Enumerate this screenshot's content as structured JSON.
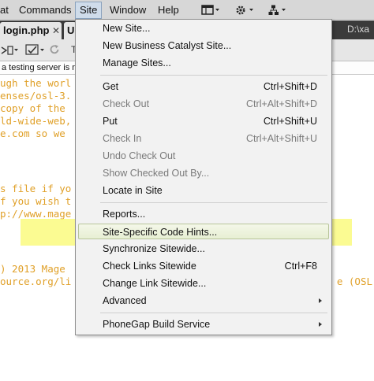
{
  "menubar": {
    "items": [
      {
        "label": "at"
      },
      {
        "label": "Commands"
      },
      {
        "label": "Site"
      },
      {
        "label": "Window"
      },
      {
        "label": "Help"
      }
    ],
    "icons": [
      "layout-icon",
      "gear-icon",
      "site-structure-icon"
    ]
  },
  "tabs": [
    {
      "label": "login.php"
    },
    {
      "label": "U"
    }
  ],
  "path_label": "D:\\xa",
  "infobar": {
    "text": "a testing server is no"
  },
  "code_lines": [
    {
      "text": "ugh the worl"
    },
    {
      "text": "enses/osl-3."
    },
    {
      "text": "copy of the"
    },
    {
      "text": "ld-wide-web,"
    },
    {
      "text": "e.com so we"
    },
    {
      "text": "s file if yo"
    },
    {
      "text": "f you wish t"
    },
    {
      "text": "p://www.mage"
    },
    {
      "text": ") 2013 Mage"
    },
    {
      "text": "ource.org/li"
    },
    {
      "text": "e (OSL"
    }
  ],
  "site_menu": {
    "items": [
      {
        "label": "New Site...",
        "shortcut": "",
        "disabled": false
      },
      {
        "label": "New Business Catalyst Site...",
        "shortcut": "",
        "disabled": false
      },
      {
        "label": "Manage Sites...",
        "shortcut": "",
        "disabled": false
      },
      {
        "label": "Get",
        "shortcut": "Ctrl+Shift+D",
        "disabled": false
      },
      {
        "label": "Check Out",
        "shortcut": "Ctrl+Alt+Shift+D",
        "disabled": true
      },
      {
        "label": "Put",
        "shortcut": "Ctrl+Shift+U",
        "disabled": false
      },
      {
        "label": "Check In",
        "shortcut": "Ctrl+Alt+Shift+U",
        "disabled": true
      },
      {
        "label": "Undo Check Out",
        "shortcut": "",
        "disabled": true
      },
      {
        "label": "Show Checked Out By...",
        "shortcut": "",
        "disabled": true
      },
      {
        "label": "Locate in Site",
        "shortcut": "",
        "disabled": false
      },
      {
        "label": "Reports...",
        "shortcut": "",
        "disabled": false
      },
      {
        "label": "Site-Specific Code Hints...",
        "shortcut": "",
        "disabled": false,
        "selected": true
      },
      {
        "label": "Synchronize Sitewide...",
        "shortcut": "",
        "disabled": false
      },
      {
        "label": "Check Links Sitewide",
        "shortcut": "Ctrl+F8",
        "disabled": false
      },
      {
        "label": "Change Link Sitewide...",
        "shortcut": "",
        "disabled": false
      },
      {
        "label": "Advanced",
        "shortcut": "",
        "disabled": false,
        "submenu": true
      },
      {
        "label": "PhoneGap Build Service",
        "shortcut": "",
        "disabled": false,
        "submenu": true
      }
    ]
  },
  "colors": {
    "code_text": "#e0a028",
    "highlight": "#f7f739",
    "menu_bg": "#f2f2f2"
  }
}
